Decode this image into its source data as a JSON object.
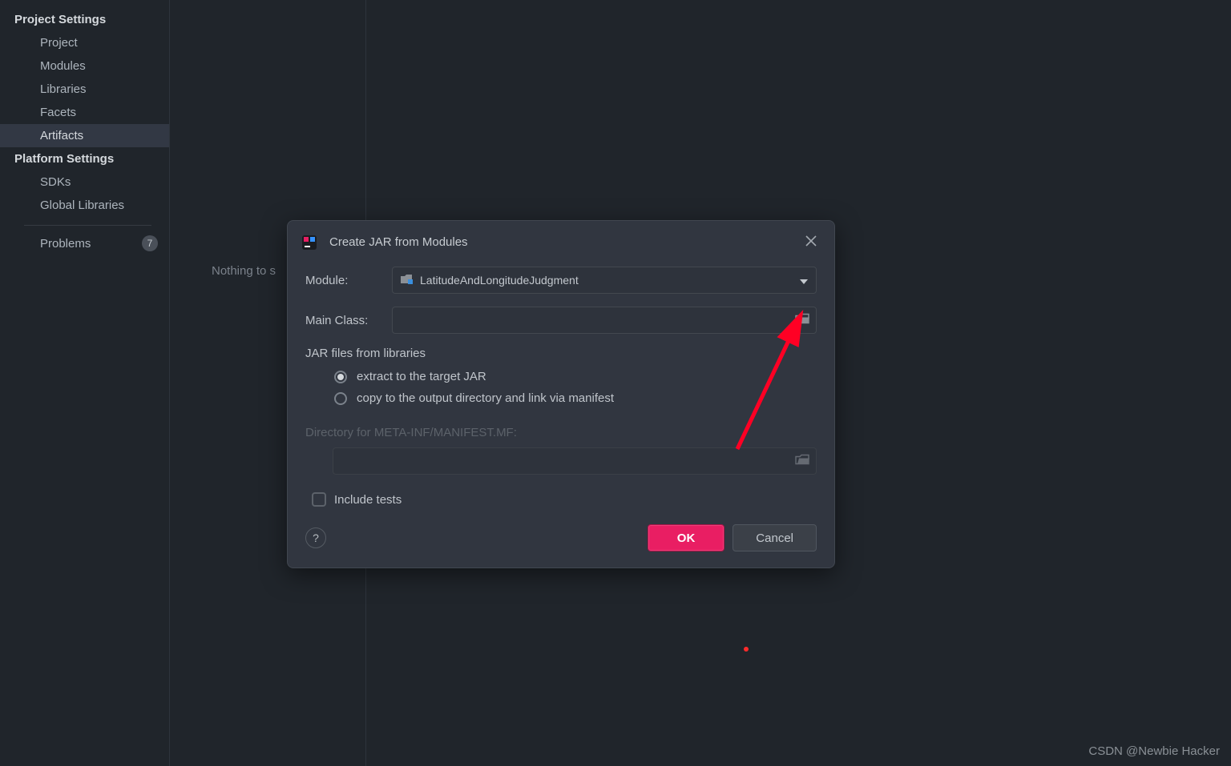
{
  "sidebar": {
    "sections": {
      "project_settings_title": "Project Settings",
      "platform_settings_title": "Platform Settings"
    },
    "items": {
      "project": "Project",
      "modules": "Modules",
      "libraries": "Libraries",
      "facets": "Facets",
      "artifacts": "Artifacts",
      "sdks": "SDKs",
      "global_libraries": "Global Libraries",
      "problems": "Problems"
    },
    "problems_count": "7"
  },
  "main": {
    "empty_text": "Nothing to s"
  },
  "dialog": {
    "title": "Create JAR from Modules",
    "module_label": "Module:",
    "module_value": "LatitudeAndLongitudeJudgment",
    "main_class_label": "Main Class:",
    "main_class_value": "",
    "jar_files_label": "JAR files from libraries",
    "radio_extract": "extract to the target JAR",
    "radio_copy": "copy to the output directory and link via manifest",
    "manifest_dir_label": "Directory for META-INF/MANIFEST.MF:",
    "manifest_dir_value": "",
    "include_tests": "Include tests",
    "help": "?",
    "ok": "OK",
    "cancel": "Cancel"
  },
  "watermark": "CSDN @Newbie Hacker"
}
